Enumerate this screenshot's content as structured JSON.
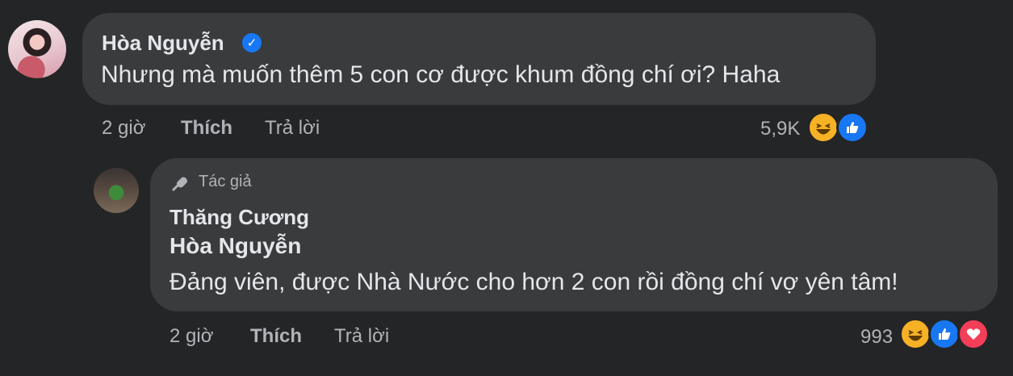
{
  "comment": {
    "author": "Hòa Nguyễn",
    "text": "Nhưng mà muốn thêm 5 con cơ được khum đồng chí ơi? Haha",
    "time": "2 giờ",
    "like_label": "Thích",
    "reply_label": "Trả lời",
    "reaction_count": "5,9K",
    "reactions": [
      "haha-icon",
      "like-icon"
    ]
  },
  "reply": {
    "author_badge": "Tác giả",
    "author": "Thăng Cương",
    "mention": "Hòa Nguyễn",
    "text": "Đảng viên, được Nhà Nước cho hơn 2 con rồi đồng chí vợ yên tâm!",
    "time": "2 giờ",
    "like_label": "Thích",
    "reply_label": "Trả lời",
    "reaction_count": "993",
    "reactions": [
      "haha-icon",
      "like-icon",
      "love-icon"
    ]
  },
  "colors": {
    "background": "#242526",
    "bubble": "#3a3b3c",
    "text": "#e4e6eb",
    "secondary": "#b0b3b8",
    "verified": "#1877f2"
  }
}
